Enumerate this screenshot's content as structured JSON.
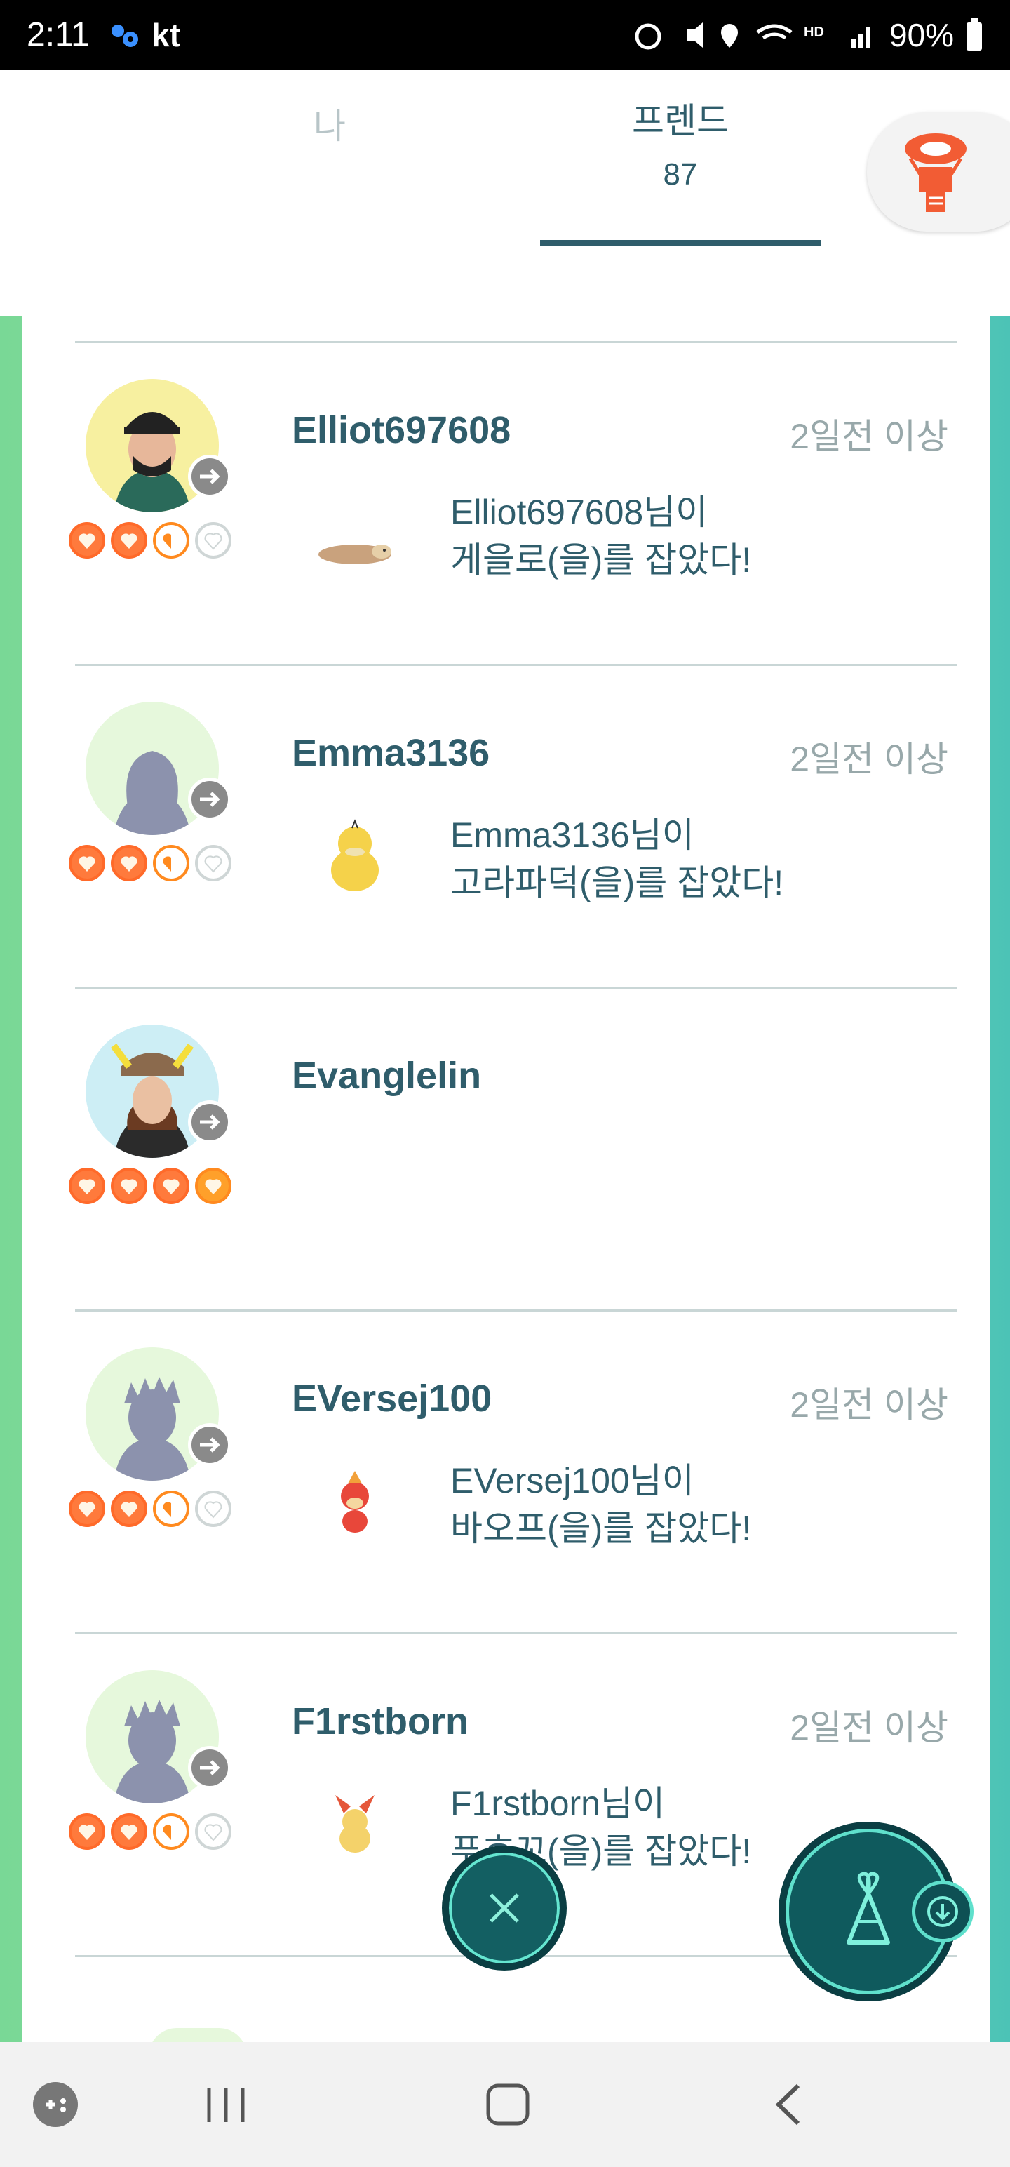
{
  "status_bar": {
    "time": "2:11",
    "carrier": "kt",
    "battery": "90%"
  },
  "tabs": {
    "me_label": "나",
    "friends_label": "프렌드",
    "friends_count": "87"
  },
  "friends": [
    {
      "name": "Elliot697608",
      "time": "2일전 이상",
      "message_line1": "Elliot697608님이",
      "message_line2": "게을로(을)를 잡았다!",
      "hearts": [
        "full",
        "full",
        "half",
        "empty"
      ],
      "avatar": "trainer-mask-cap",
      "pokemon": "slakoth-icon"
    },
    {
      "name": "Emma3136",
      "time": "2일전 이상",
      "message_line1": "Emma3136님이",
      "message_line2": "고라파덕(을)를 잡았다!",
      "hearts": [
        "full",
        "full",
        "half",
        "empty"
      ],
      "avatar": "silhouette-female",
      "pokemon": "psyduck-icon"
    },
    {
      "name": "Evanglelin",
      "time": "",
      "message_line1": "",
      "message_line2": "",
      "hearts": [
        "full",
        "full",
        "full",
        "full"
      ],
      "avatar": "trainer-pikachu-hat",
      "pokemon": ""
    },
    {
      "name": "EVersej100",
      "time": "2일전 이상",
      "message_line1": "EVersej100님이",
      "message_line2": "바오프(을)를 잡았다!",
      "hearts": [
        "full",
        "full",
        "half",
        "empty"
      ],
      "avatar": "silhouette-male",
      "pokemon": "pansear-icon"
    },
    {
      "name": "F1rstborn",
      "time": "2일전 이상",
      "message_line1": "F1rstborn님이",
      "message_line2": "푸호꼬(을)를 잡았다!",
      "hearts": [
        "full",
        "full",
        "half",
        "empty"
      ],
      "avatar": "silhouette-male",
      "pokemon": "fennekin-icon"
    }
  ],
  "colors": {
    "accent": "#2f5d6b",
    "heart": "#ff7a3c",
    "heart_half": "#ff8a1f"
  }
}
